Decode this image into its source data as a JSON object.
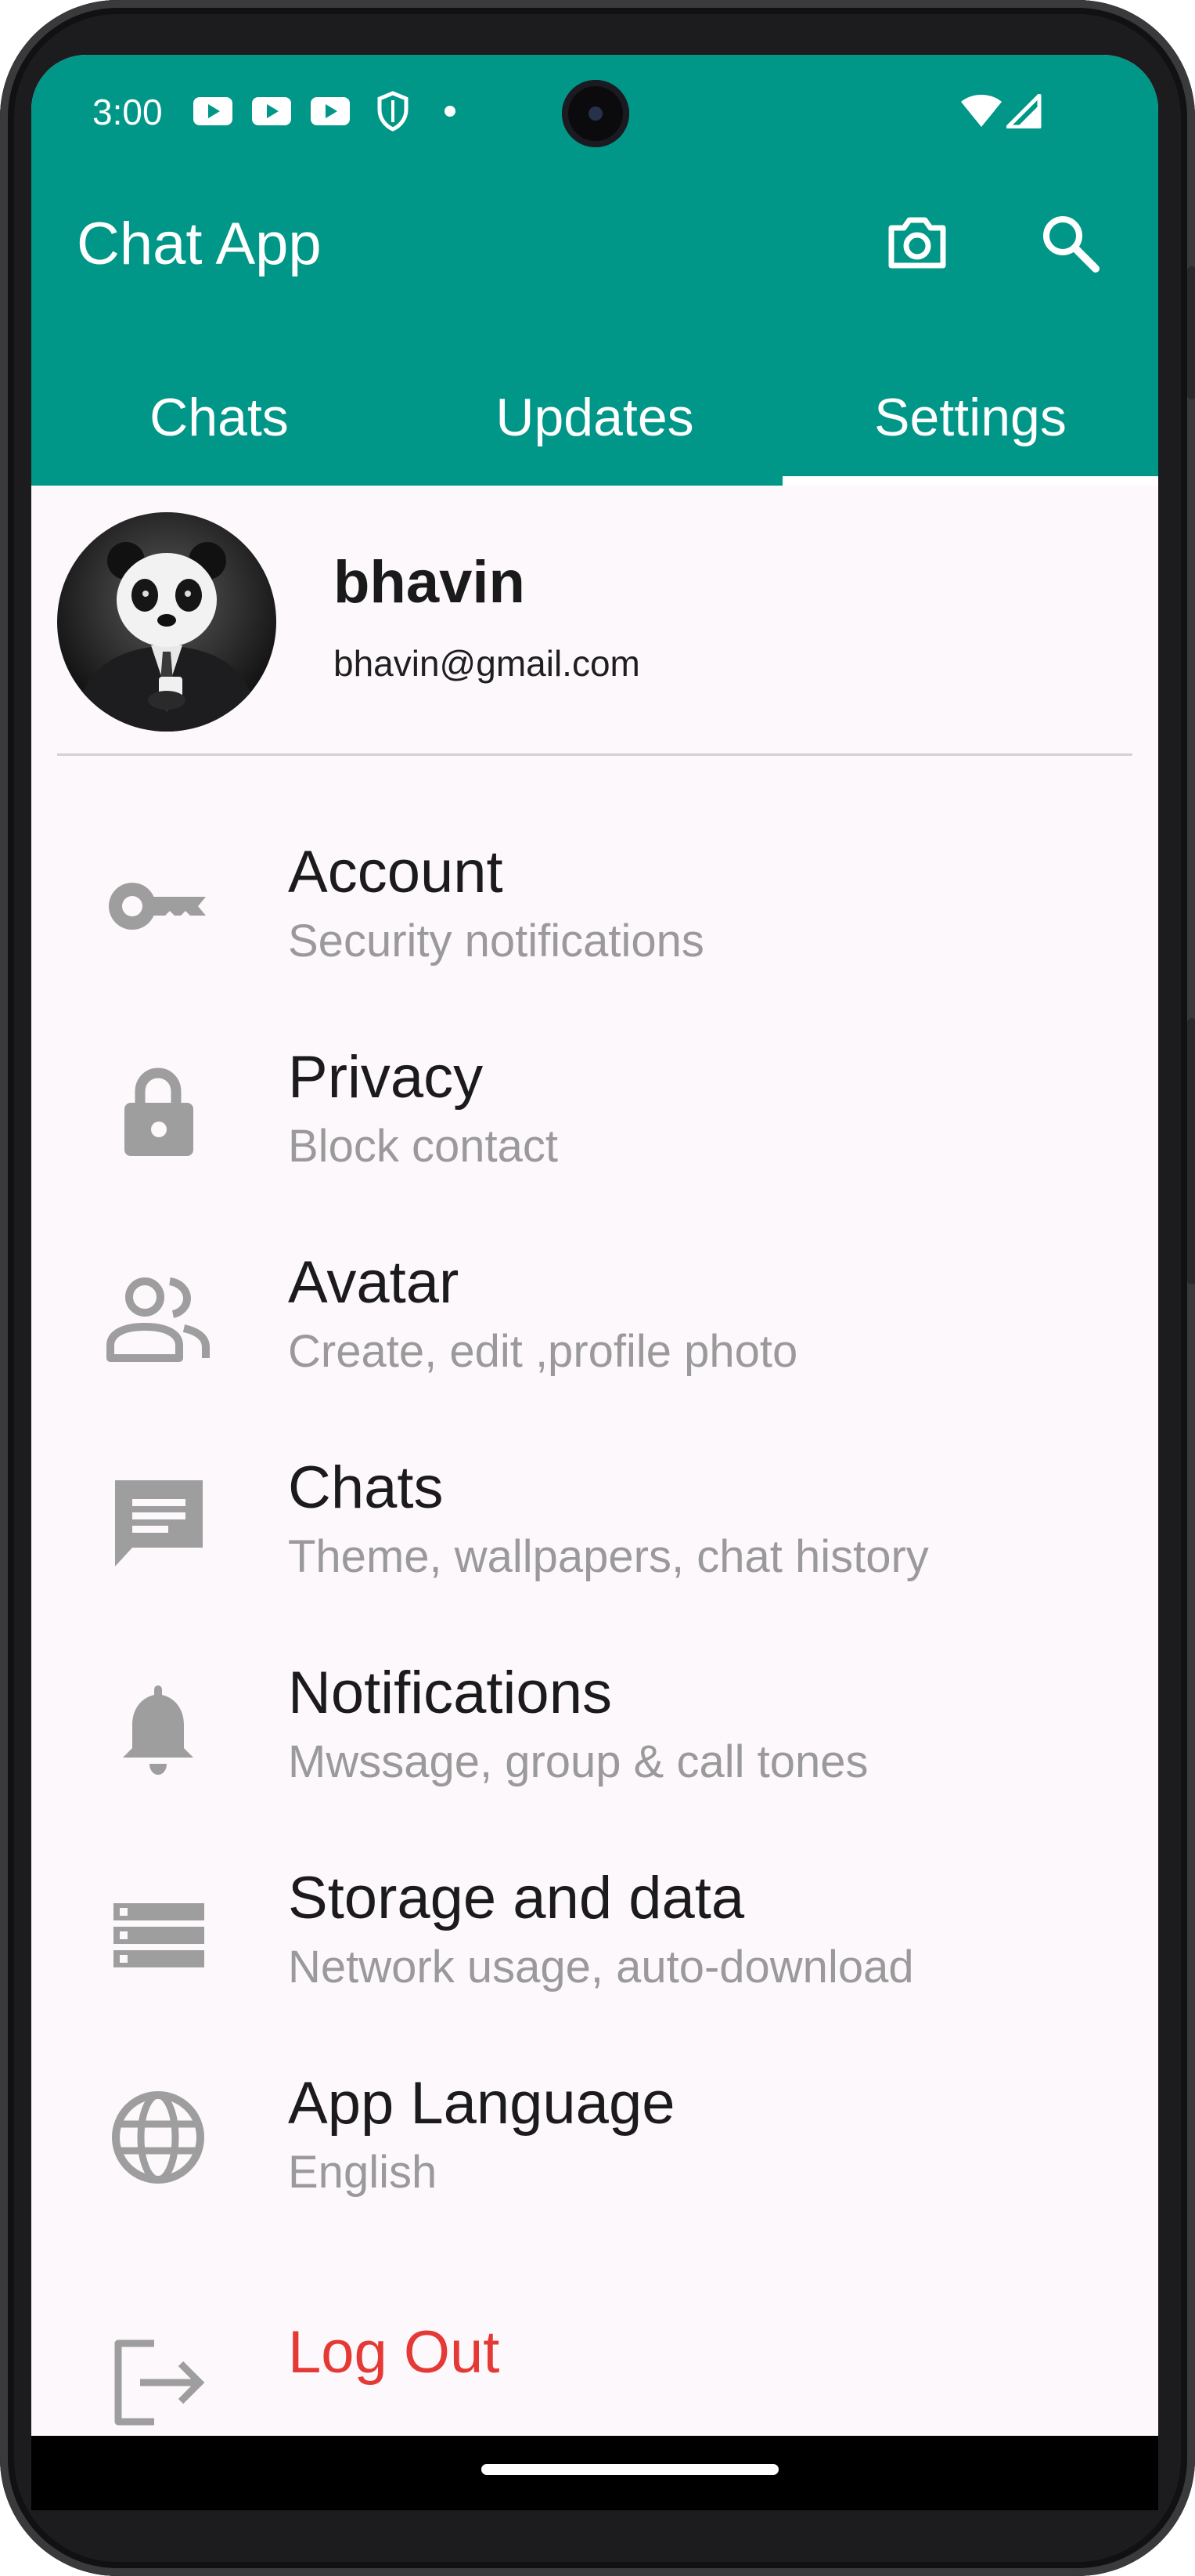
{
  "status_bar": {
    "time": "3:00",
    "notification_icons": [
      "youtube-icon",
      "youtube-icon",
      "youtube-icon",
      "shield-icon",
      "dot-icon"
    ],
    "right_icons": [
      "wifi-icon",
      "signal-icon"
    ]
  },
  "app_bar": {
    "title": "Chat App",
    "actions": [
      "camera-icon",
      "search-icon"
    ]
  },
  "tabs": [
    {
      "label": "Chats",
      "selected": false
    },
    {
      "label": "Updates",
      "selected": false
    },
    {
      "label": "Settings",
      "selected": true
    }
  ],
  "profile": {
    "name": "bhavin",
    "email": "bhavin@gmail.com"
  },
  "settings": [
    {
      "title": "Account",
      "subtitle": "Security notifications",
      "icon": "key-icon"
    },
    {
      "title": "Privacy",
      "subtitle": "Block contact",
      "icon": "lock-icon"
    },
    {
      "title": "Avatar",
      "subtitle": "Create, edit ,profile photo",
      "icon": "people-icon"
    },
    {
      "title": "Chats",
      "subtitle": "Theme, wallpapers, chat history",
      "icon": "chat-icon"
    },
    {
      "title": "Notifications",
      "subtitle": "Mwssage, group & call tones",
      "icon": "bell-icon"
    },
    {
      "title": "Storage and data",
      "subtitle": "Network usage, auto-download",
      "icon": "storage-icon"
    },
    {
      "title": "App Language",
      "subtitle": "English",
      "icon": "globe-icon"
    }
  ],
  "logout": {
    "title": "Log Out",
    "icon": "logout-icon"
  },
  "colors": {
    "primary": "#009688",
    "logout": "#e53935",
    "icon_gray": "#9e9e9e",
    "subtitle_gray": "#9a9a9a",
    "background": "#fdf8fb"
  }
}
